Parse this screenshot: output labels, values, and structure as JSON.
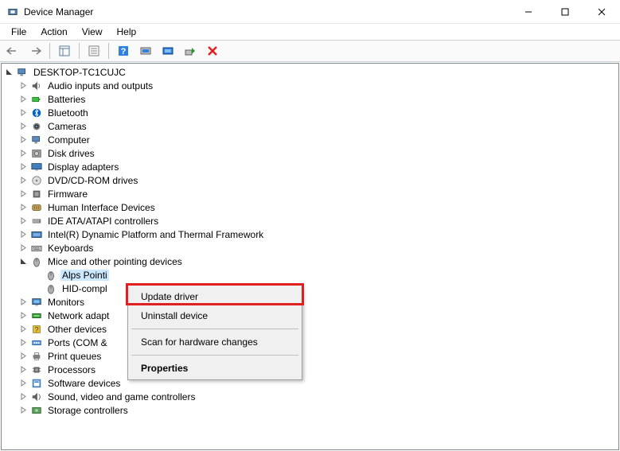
{
  "window": {
    "title": "Device Manager"
  },
  "menu": [
    "File",
    "Action",
    "View",
    "Help"
  ],
  "tree": {
    "root": "DESKTOP-TC1CUJC",
    "nodes": [
      {
        "label": "Audio inputs and outputs",
        "icon": "audio"
      },
      {
        "label": "Batteries",
        "icon": "battery"
      },
      {
        "label": "Bluetooth",
        "icon": "bluetooth"
      },
      {
        "label": "Cameras",
        "icon": "camera"
      },
      {
        "label": "Computer",
        "icon": "computer"
      },
      {
        "label": "Disk drives",
        "icon": "disk"
      },
      {
        "label": "Display adapters",
        "icon": "display"
      },
      {
        "label": "DVD/CD-ROM drives",
        "icon": "dvd"
      },
      {
        "label": "Firmware",
        "icon": "firmware"
      },
      {
        "label": "Human Interface Devices",
        "icon": "hid"
      },
      {
        "label": "IDE ATA/ATAPI controllers",
        "icon": "ide"
      },
      {
        "label": "Intel(R) Dynamic Platform and Thermal Framework",
        "icon": "thermal"
      },
      {
        "label": "Keyboards",
        "icon": "keyboard"
      },
      {
        "label": "Mice and other pointing devices",
        "icon": "mouse",
        "open": true,
        "children": [
          {
            "label": "Alps Pointi",
            "icon": "mouse",
            "selected": true
          },
          {
            "label": "HID-compl",
            "icon": "mouse"
          }
        ]
      },
      {
        "label": "Monitors",
        "icon": "monitor"
      },
      {
        "label": "Network adapt",
        "icon": "network"
      },
      {
        "label": "Other devices",
        "icon": "other"
      },
      {
        "label": "Ports (COM &",
        "icon": "port"
      },
      {
        "label": "Print queues",
        "icon": "printer"
      },
      {
        "label": "Processors",
        "icon": "cpu"
      },
      {
        "label": "Software devices",
        "icon": "software"
      },
      {
        "label": "Sound, video and game controllers",
        "icon": "sound"
      },
      {
        "label": "Storage controllers",
        "icon": "storage"
      }
    ]
  },
  "context_menu": {
    "items": [
      {
        "label": "Update driver",
        "highlighted": true
      },
      {
        "label": "Uninstall device"
      },
      {
        "sep": true
      },
      {
        "label": "Scan for hardware changes"
      },
      {
        "sep": true
      },
      {
        "label": "Properties",
        "bold": true
      }
    ]
  }
}
